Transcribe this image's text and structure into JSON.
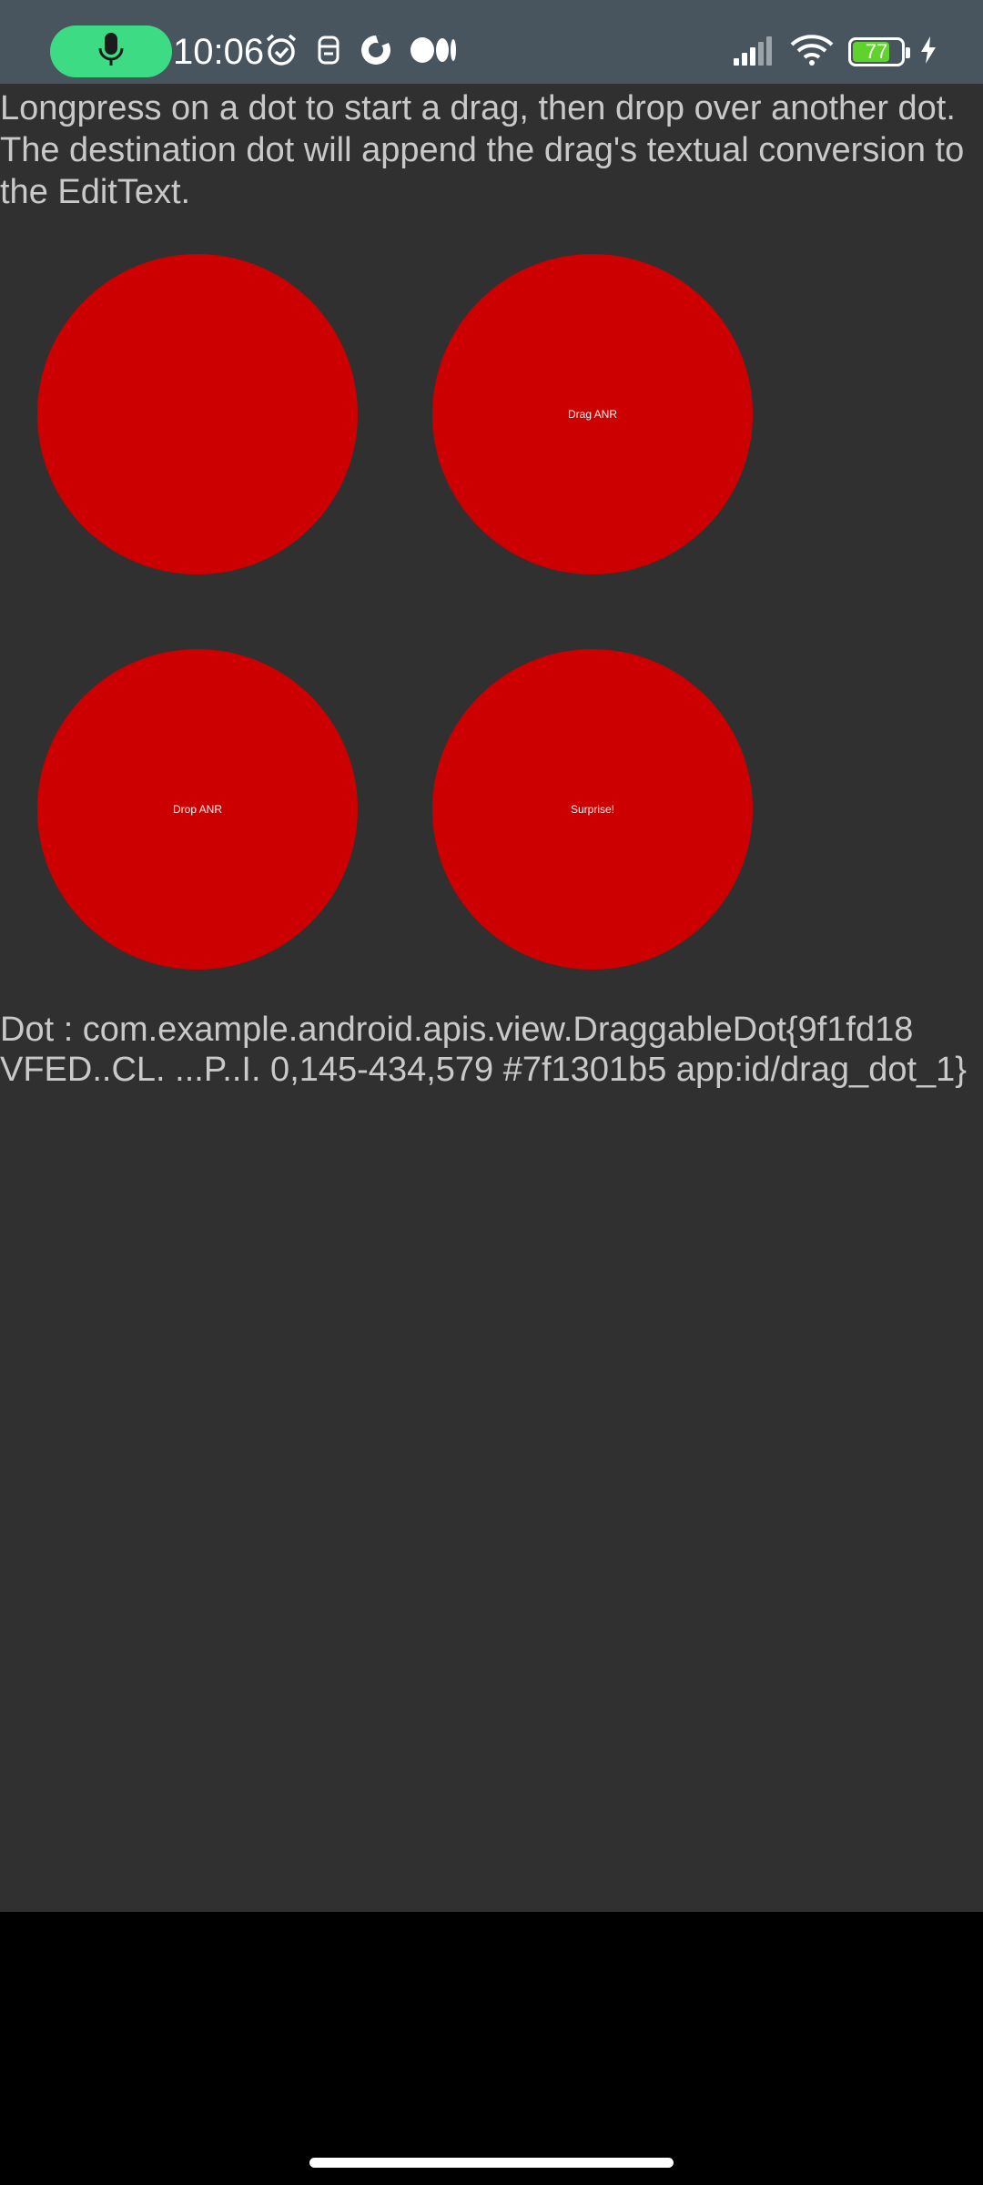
{
  "status_bar": {
    "time": "10:06",
    "battery_level": "77",
    "battery_fraction": 0.77,
    "accent_color": "#3ddc84",
    "battery_color": "#5fd22b",
    "icons": [
      "mic-icon",
      "alarm-icon",
      "app-notification-icon",
      "app-notification-icon",
      "medium-icon",
      "signal-icon",
      "wifi-icon",
      "battery-icon",
      "charging-icon"
    ]
  },
  "main": {
    "instructions": "Longpress on a dot to start a drag, then drop over another dot. The destination dot will append the drag's textual conversion to the EditText.",
    "dot_color": "#cc0000",
    "dots": [
      {
        "label": ""
      },
      {
        "label": "Drag ANR"
      },
      {
        "label": "Drop ANR"
      },
      {
        "label": "Surprise!"
      }
    ],
    "result_text": "Dot : com.example.android.apis.view.DraggableDot{9f1fd18 VFED..CL. ...P..I. 0,145-434,579 #7f1301b5 app:id/drag_dot_1}"
  }
}
